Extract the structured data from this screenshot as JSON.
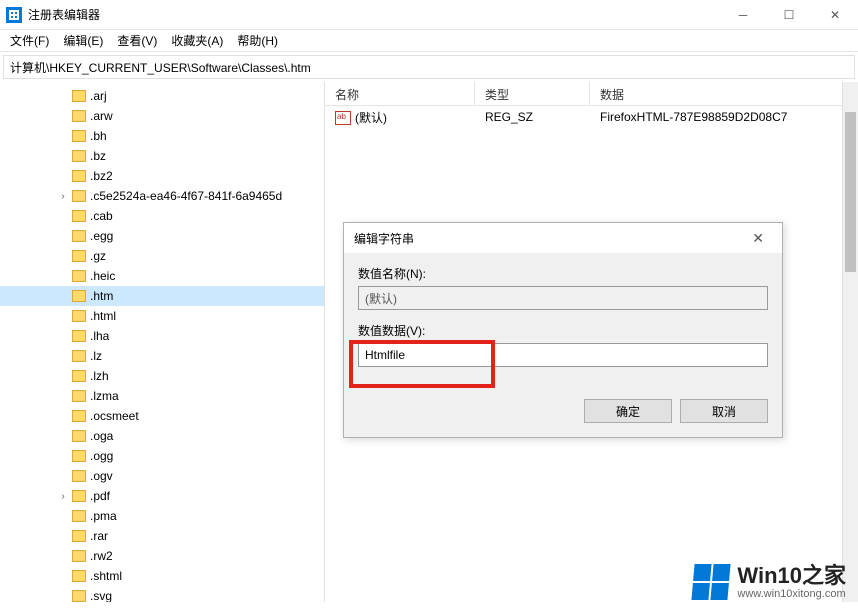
{
  "window": {
    "title": "注册表编辑器"
  },
  "menu": {
    "file": "文件(F)",
    "edit": "编辑(E)",
    "view": "查看(V)",
    "favorites": "收藏夹(A)",
    "help": "帮助(H)"
  },
  "path": "计算机\\HKEY_CURRENT_USER\\Software\\Classes\\.htm",
  "tree": {
    "items": [
      {
        "label": ".arj",
        "expander": ""
      },
      {
        "label": ".arw",
        "expander": ""
      },
      {
        "label": ".bh",
        "expander": ""
      },
      {
        "label": ".bz",
        "expander": ""
      },
      {
        "label": ".bz2",
        "expander": ""
      },
      {
        "label": ".c5e2524a-ea46-4f67-841f-6a9465d",
        "expander": "›"
      },
      {
        "label": ".cab",
        "expander": ""
      },
      {
        "label": ".egg",
        "expander": ""
      },
      {
        "label": ".gz",
        "expander": ""
      },
      {
        "label": ".heic",
        "expander": ""
      },
      {
        "label": ".htm",
        "expander": "",
        "selected": true
      },
      {
        "label": ".html",
        "expander": ""
      },
      {
        "label": ".lha",
        "expander": ""
      },
      {
        "label": ".lz",
        "expander": ""
      },
      {
        "label": ".lzh",
        "expander": ""
      },
      {
        "label": ".lzma",
        "expander": ""
      },
      {
        "label": ".ocsmeet",
        "expander": ""
      },
      {
        "label": ".oga",
        "expander": ""
      },
      {
        "label": ".ogg",
        "expander": ""
      },
      {
        "label": ".ogv",
        "expander": ""
      },
      {
        "label": ".pdf",
        "expander": "›"
      },
      {
        "label": ".pma",
        "expander": ""
      },
      {
        "label": ".rar",
        "expander": ""
      },
      {
        "label": ".rw2",
        "expander": ""
      },
      {
        "label": ".shtml",
        "expander": ""
      },
      {
        "label": ".svg",
        "expander": ""
      }
    ]
  },
  "list": {
    "headers": {
      "name": "名称",
      "type": "类型",
      "data": "数据"
    },
    "rows": [
      {
        "name": "(默认)",
        "type": "REG_SZ",
        "data": "FirefoxHTML-787E98859D2D08C7"
      }
    ]
  },
  "dialog": {
    "title": "编辑字符串",
    "name_label": "数值名称(N):",
    "name_value": "(默认)",
    "data_label": "数值数据(V):",
    "data_value": "Htmlfile",
    "ok": "确定",
    "cancel": "取消"
  },
  "watermark": {
    "title": "Win10之家",
    "sub": "www.win10xitong.com"
  }
}
